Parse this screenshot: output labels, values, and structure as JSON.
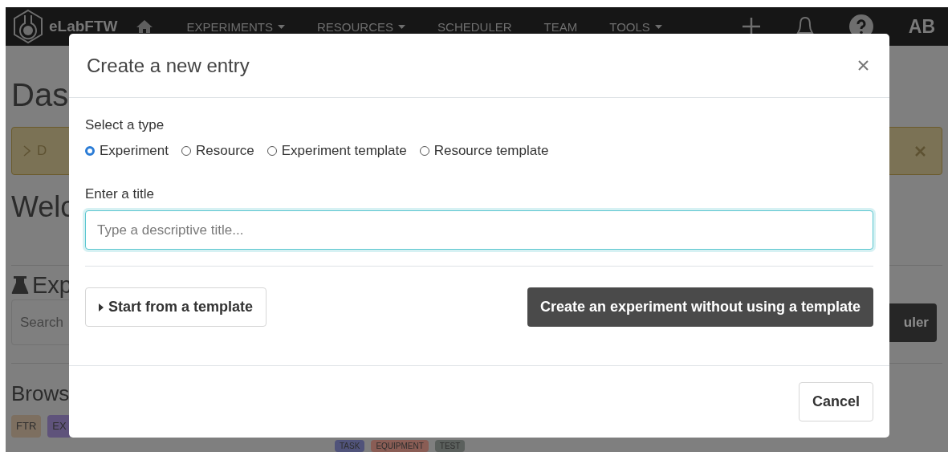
{
  "navbar": {
    "brand": "eLabFTW",
    "items": [
      {
        "label": "EXPERIMENTS",
        "has_menu": true
      },
      {
        "label": "RESOURCES",
        "has_menu": true
      },
      {
        "label": "SCHEDULER",
        "has_menu": false
      },
      {
        "label": "TEAM",
        "has_menu": false
      },
      {
        "label": "TOOLS",
        "has_menu": true
      }
    ],
    "user_initials": "AB"
  },
  "page": {
    "title": "Das",
    "alert": {
      "text": "D"
    },
    "welcome": "Welc",
    "section_title": "Exp",
    "search": {
      "placeholder": "Search"
    },
    "button": "uler",
    "browse_title": "Brows",
    "tags": [
      {
        "label": "FTR",
        "color": "#7d6f60"
      },
      {
        "label": "EX",
        "color": "#5f537b"
      }
    ],
    "tags_lower": [
      {
        "label": "TASK",
        "color": "#50537a"
      },
      {
        "label": "EQUIPMENT",
        "color": "#8a5d55"
      },
      {
        "label": "TEST",
        "color": "#5b605d"
      }
    ]
  },
  "modal": {
    "title": "Create a new entry",
    "type_label": "Select a type",
    "types": [
      {
        "label": "Experiment",
        "selected": true
      },
      {
        "label": "Resource",
        "selected": false
      },
      {
        "label": "Experiment template",
        "selected": false
      },
      {
        "label": "Resource template",
        "selected": false
      }
    ],
    "title_label": "Enter a title",
    "title_field": {
      "placeholder": "Type a descriptive title..."
    },
    "template_button": "Start from a template",
    "create_button": "Create an experiment without using a template",
    "cancel_button": "Cancel"
  }
}
